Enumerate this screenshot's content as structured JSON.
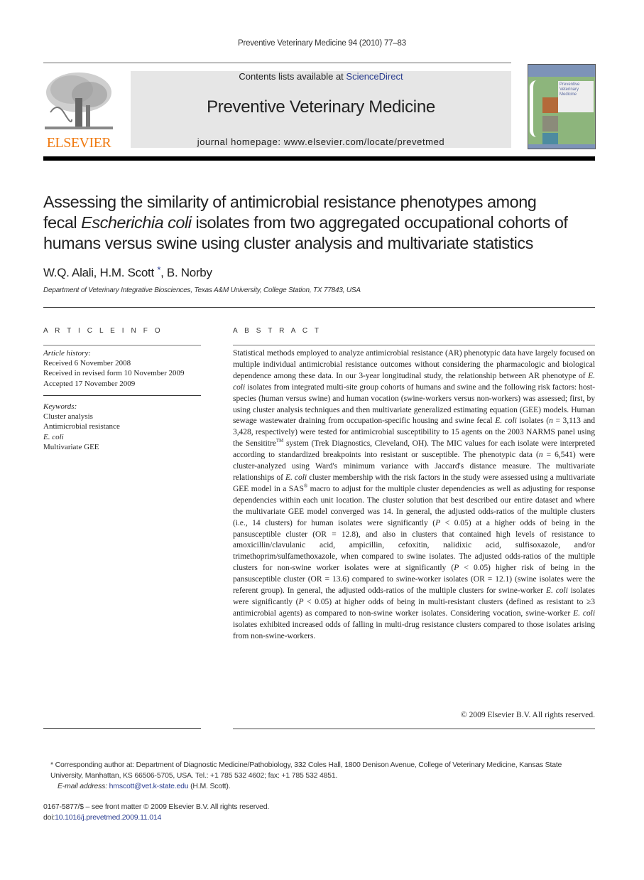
{
  "running_head": "Preventive Veterinary Medicine 94 (2010) 77–83",
  "banner": {
    "contents_prefix": "Contents lists available at ",
    "contents_link": "ScienceDirect",
    "journal_name": "Preventive Veterinary Medicine",
    "homepage": "journal homepage: www.elsevier.com/locate/prevetmed",
    "publisher_logo_text": "ELSEVIER",
    "cover_title": "Preventive Veterinary Medicine"
  },
  "colors": {
    "elsevier_orange": "#f07c14",
    "link_blue": "#2a3d8f",
    "banner_gray": "#e6e6e6",
    "cover_green": "#8db57c"
  },
  "article": {
    "title_lines": [
      "Assessing the similarity of antimicrobial resistance phenotypes among",
      [
        "fecal ",
        "Escherichia coli",
        " isolates from two aggregated occupational cohorts of"
      ],
      "humans versus swine using cluster analysis and multivariate statistics"
    ],
    "title_line1": "Assessing the similarity of antimicrobial resistance phenotypes among",
    "title_line2_pre": "fecal ",
    "title_line2_italic": "Escherichia coli",
    "title_line2_post": " isolates from two aggregated occupational cohorts of",
    "title_line3": "humans versus swine using cluster analysis and multivariate statistics",
    "authors_pre": "W.Q. Alali, H.M. Scott ",
    "authors_star": "*",
    "authors_post": ", B. Norby",
    "affiliation": "Department of Veterinary Integrative Biosciences, Texas A&M University, College Station, TX 77843, USA"
  },
  "article_info": {
    "label": "A R T I C L E   I N F O",
    "history_head": "Article history:",
    "history": [
      "Received 6 November 2008",
      "Received in revised form 10 November 2009",
      "Accepted 17 November 2009"
    ],
    "keywords_head": "Keywords:",
    "keywords": [
      "Cluster analysis",
      "Antimicrobial resistance",
      "E. coli",
      "Multivariate GEE"
    ]
  },
  "abstract": {
    "label": "A B S T R A C T",
    "segments": {
      "s1": "Statistical methods employed to analyze antimicrobial resistance (AR) phenotypic data have largely focused on multiple individual antimicrobial resistance outcomes without considering the pharmacologic and biological dependence among these data. In our 3-year longitudinal study, the relationship between AR phenotype of ",
      "i1": "E. coli",
      "s2": " isolates from integrated multi-site group cohorts of humans and swine and the following risk factors: host-species (human versus swine) and human vocation (swine-workers versus non-workers) was assessed; first, by using cluster analysis techniques and then multivariate generalized estimating equation (GEE) models. Human sewage wastewater draining from occupation-specific housing and swine fecal ",
      "i2": "E. coli",
      "s3": " isolates (",
      "i3": "n",
      "s4": " = 3,113 and 3,428, respectively) were tested for antimicrobial susceptibility to 15 agents on the 2003 NARMS panel using the Sensititre",
      "sup1": "TM",
      "s5": " system (Trek Diagnostics, Cleveland, OH). The MIC values for each isolate were interpreted according to standardized breakpoints into resistant or susceptible. The phenotypic data (",
      "i4": "n",
      "s6": " = 6,541) were cluster-analyzed using Ward's minimum variance with Jaccard's distance measure. The multivariate relationships of ",
      "i5": "E. coli",
      "s7": " cluster membership with the risk factors in the study were assessed using a multivariate GEE model in a SAS",
      "sup2": "®",
      "s8": " macro to adjust for the multiple cluster dependencies as well as adjusting for response dependencies within each unit location. The cluster solution that best described our entire dataset and where the multivariate GEE model converged was 14. In general, the adjusted odds-ratios of the multiple clusters (i.e., 14 clusters) for human isolates were significantly (",
      "i6": "P",
      "s9": " < 0.05) at a higher odds of being in the pansusceptible cluster (OR = 12.8), and also in clusters that contained high levels of resistance to amoxicillin/clavulanic acid, ampicillin, cefoxitin, nalidixic acid, sulfisoxazole, and/or trimethoprim/sulfamethoxazole, when compared to swine isolates. The adjusted odds-ratios of the multiple clusters for non-swine worker isolates were at significantly (",
      "i7": "P",
      "s10": " < 0.05) higher risk of being in the pansusceptible cluster (OR = 13.6) compared to swine-worker isolates (OR = 12.1) (swine isolates were the referent group). In general, the adjusted odds-ratios of the multiple clusters for swine-worker ",
      "i8": "E. coli",
      "s11": " isolates were significantly (",
      "i9": "P",
      "s12": " < 0.05) at higher odds of being in multi-resistant clusters (defined as resistant to ≥3 antimicrobial agents) as compared to non-swine worker isolates. Considering vocation, swine-worker ",
      "i10": "E. coli",
      "s13": " isolates exhibited increased odds of falling in multi-drug resistance clusters compared to those isolates arising from non-swine-workers."
    },
    "copyright": "© 2009 Elsevier B.V. All rights reserved."
  },
  "footnote": {
    "star": "*",
    "corresponding": " Corresponding author at: Department of Diagnostic Medicine/Pathobiology, 332 Coles Hall, 1800 Denison Avenue, College of Veterinary Medicine, Kansas State University, Manhattan, KS 66506-5705, USA. Tel.: +1 785 532 4602; fax: +1 785 532 4851.",
    "email_label": "E-mail address:",
    "email": "hmscott@vet.k-state.edu",
    "email_suffix": " (H.M. Scott)."
  },
  "front_matter": {
    "issn_line": "0167-5877/$ – see front matter © 2009 Elsevier B.V. All rights reserved.",
    "doi_prefix": "doi:",
    "doi": "10.1016/j.prevetmed.2009.11.014"
  }
}
